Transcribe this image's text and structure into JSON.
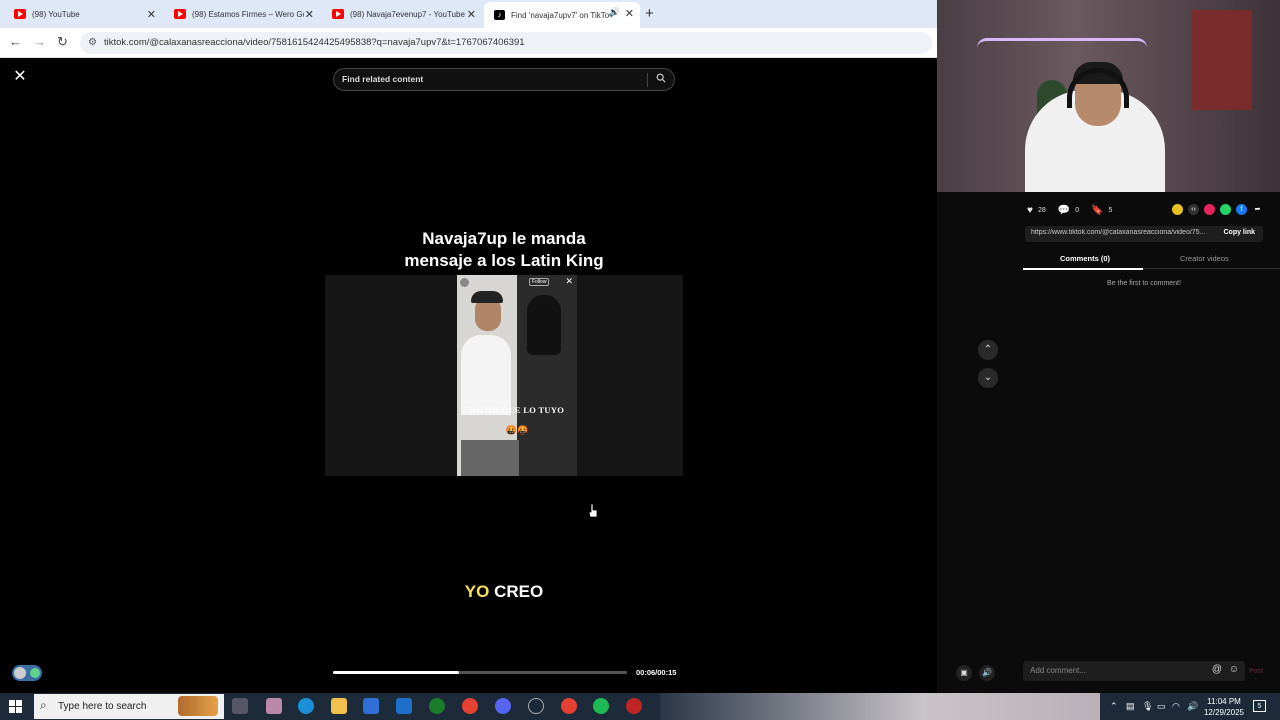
{
  "browser": {
    "tabs": [
      {
        "label": "(98) YouTube",
        "favicon": "youtube-icon"
      },
      {
        "label": "(98) Estamos Firmes – Wero Go",
        "favicon": "youtube-icon"
      },
      {
        "label": "(98) Navaja7evenup7 - YouTube",
        "favicon": "youtube-icon"
      },
      {
        "label": "Find 'navaja7upv7' on TikTok",
        "favicon": "tiktok-icon",
        "active": true
      }
    ],
    "url": "tiktok.com/@calaxanasreacciona/video/7581615424425495838?q=navaja7upv7&t=1767067406391"
  },
  "tiktok": {
    "search_placeholder": "Find related content",
    "video_title_line1": "Navaja7up le manda",
    "video_title_line2": "mensaje a los Latin King",
    "embed": {
      "follow_label": "Follow",
      "caption": "NO NIEGUE LO TUYO",
      "emojis": "🤬🤬"
    },
    "subtitle_highlight": "YO",
    "subtitle_rest": "CREO",
    "progress": 0.43,
    "time": "00:06/00:15"
  },
  "side": {
    "likes": "28",
    "comments": "0",
    "saves": "5",
    "link": "https://www.tiktok.com/@calaxanasreacciona/video/75...",
    "copy_label": "Copy link",
    "tab_comments": "Comments (0)",
    "tab_creator": "Creator videos",
    "empty_text": "Be the first to comment!",
    "comment_placeholder": "Add comment...",
    "post_label": "Post"
  },
  "taskbar": {
    "search_placeholder": "Type here to search",
    "time": "11:04 PM",
    "date": "12/29/2025",
    "notifications": "5"
  }
}
